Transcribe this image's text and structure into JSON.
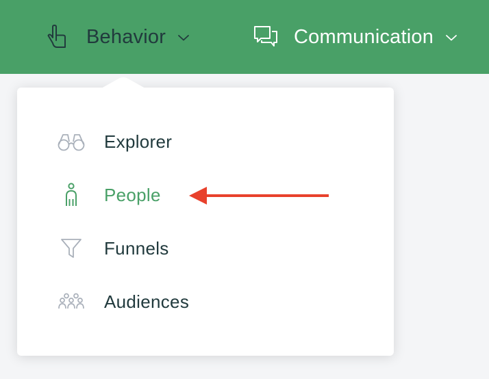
{
  "topbar": {
    "background": "#49a067",
    "items": [
      {
        "label": "Behavior",
        "icon": "pointing-hand-icon",
        "expanded": true
      },
      {
        "label": "Communication",
        "icon": "chat-bubbles-icon",
        "expanded": false
      }
    ]
  },
  "dropdown": {
    "items": [
      {
        "label": "Explorer",
        "icon": "binoculars-icon",
        "active": false
      },
      {
        "label": "People",
        "icon": "person-icon",
        "active": true
      },
      {
        "label": "Funnels",
        "icon": "funnel-icon",
        "active": false
      },
      {
        "label": "Audiences",
        "icon": "group-icon",
        "active": false
      }
    ]
  },
  "annotation": {
    "type": "arrow",
    "color": "#e8412c",
    "points_to": "People"
  },
  "colors": {
    "accent": "#49a067",
    "text_dark": "#213a3d",
    "icon_gray": "#a9b0ba",
    "arrow": "#e8412c"
  }
}
